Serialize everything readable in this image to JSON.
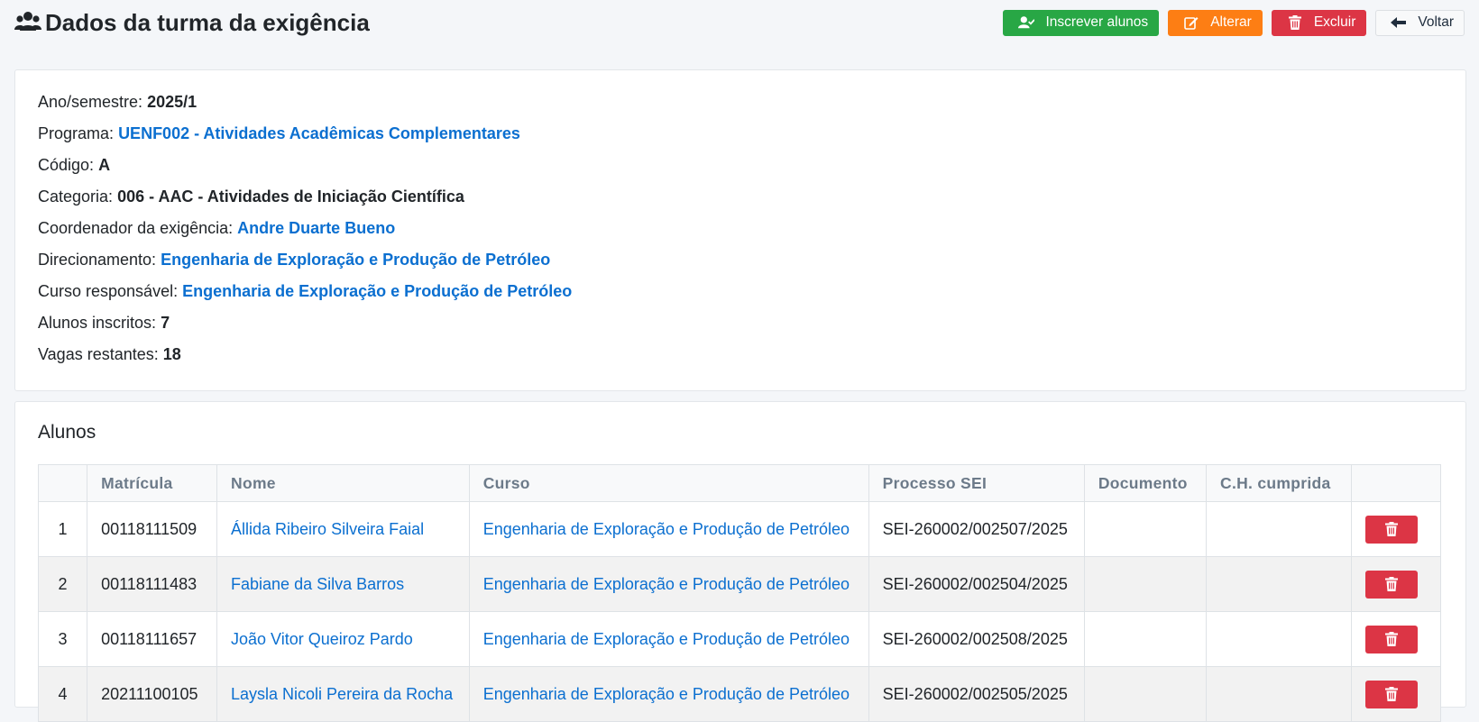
{
  "header": {
    "title": "Dados da turma da exigência",
    "title_icon": "users-icon",
    "buttons": {
      "enroll": "Inscrever alunos",
      "edit": "Alterar",
      "delete": "Excluir",
      "back": "Voltar"
    }
  },
  "info": {
    "ano_label": "Ano/semestre:",
    "ano_value": "2025/1",
    "programa_label": "Programa:",
    "programa_value": "UENF002 - Atividades Acadêmicas Complementares",
    "codigo_label": "Código:",
    "codigo_value": "A",
    "categoria_label": "Categoria:",
    "categoria_value": "006 - AAC - Atividades de Iniciação Científica",
    "coordenador_label": "Coordenador da exigência:",
    "coordenador_value": "Andre Duarte Bueno",
    "direcionamento_label": "Direcionamento:",
    "direcionamento_value": "Engenharia de Exploração e Produção de Petróleo",
    "curso_label": "Curso responsável:",
    "curso_value": "Engenharia de Exploração e Produção de Petróleo",
    "inscritos_label": "Alunos inscritos:",
    "inscritos_value": "7",
    "vagas_label": "Vagas restantes:",
    "vagas_value": "18"
  },
  "students": {
    "title": "Alunos",
    "columns": [
      "",
      "Matrícula",
      "Nome",
      "Curso",
      "Processo SEI",
      "Documento",
      "C.H. cumprida",
      ""
    ],
    "rows": [
      {
        "n": "1",
        "matricula": "00118111509",
        "nome": "Állida Ribeiro Silveira Faial",
        "curso": "Engenharia de Exploração e Produção de Petróleo",
        "sei": "SEI-260002/002507/2025",
        "documento": "",
        "ch": ""
      },
      {
        "n": "2",
        "matricula": "00118111483",
        "nome": "Fabiane da Silva Barros",
        "curso": "Engenharia de Exploração e Produção de Petróleo",
        "sei": "SEI-260002/002504/2025",
        "documento": "",
        "ch": ""
      },
      {
        "n": "3",
        "matricula": "00118111657",
        "nome": "João Vitor Queiroz Pardo",
        "curso": "Engenharia de Exploração e Produção de Petróleo",
        "sei": "SEI-260002/002508/2025",
        "documento": "",
        "ch": ""
      },
      {
        "n": "4",
        "matricula": "20211100105",
        "nome": "Laysla Nicoli Pereira da Rocha",
        "curso": "Engenharia de Exploração e Produção de Petróleo",
        "sei": "SEI-260002/002505/2025",
        "documento": "",
        "ch": ""
      }
    ]
  },
  "colors": {
    "green": "#28a745",
    "orange": "#fd7e14",
    "red": "#dc3545",
    "link": "#0b6fd0"
  }
}
